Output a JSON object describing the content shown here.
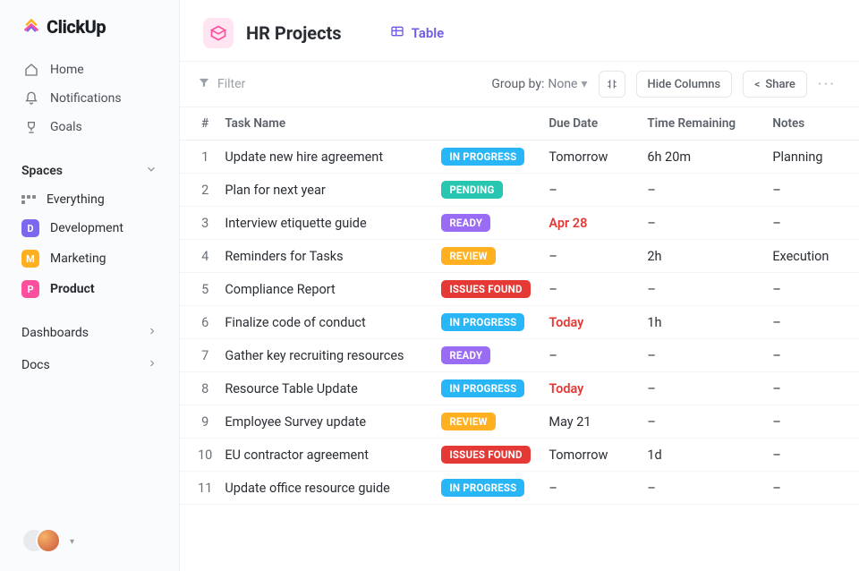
{
  "brand": {
    "name": "ClickUp"
  },
  "nav": {
    "home": "Home",
    "notifications": "Notifications",
    "goals": "Goals"
  },
  "sidebar": {
    "spaces_label": "Spaces",
    "everything": "Everything",
    "spaces": [
      {
        "letter": "D",
        "label": "Development",
        "class": "badge-d"
      },
      {
        "letter": "M",
        "label": "Marketing",
        "class": "badge-m"
      },
      {
        "letter": "P",
        "label": "Product",
        "class": "badge-p",
        "active": true
      }
    ],
    "dashboards": "Dashboards",
    "docs": "Docs"
  },
  "header": {
    "title": "HR Projects",
    "view_label": "Table"
  },
  "toolbar": {
    "filter": "Filter",
    "groupby_label": "Group by:",
    "groupby_value": "None",
    "hide_columns": "Hide Columns",
    "share": "Share"
  },
  "table": {
    "columns": {
      "num": "#",
      "task": "Task Name",
      "status": "",
      "due": "Due Date",
      "time": "Time Remaining",
      "notes": "Notes"
    },
    "status_labels": {
      "inprogress": "IN PROGRESS",
      "pending": "PENDING",
      "ready": "READY",
      "review": "REVIEW",
      "issues": "ISSUES FOUND"
    },
    "rows": [
      {
        "n": "1",
        "task": "Update new hire agreement",
        "status": "inprogress",
        "due": "Tomorrow",
        "due_hl": false,
        "time": "6h 20m",
        "notes": "Planning"
      },
      {
        "n": "2",
        "task": "Plan for next year",
        "status": "pending",
        "due": "–",
        "due_hl": false,
        "time": "–",
        "notes": "–"
      },
      {
        "n": "3",
        "task": "Interview etiquette guide",
        "status": "ready",
        "due": "Apr 28",
        "due_hl": true,
        "time": "–",
        "notes": "–"
      },
      {
        "n": "4",
        "task": "Reminders for Tasks",
        "status": "review",
        "due": "–",
        "due_hl": false,
        "time": "2h",
        "notes": "Execution"
      },
      {
        "n": "5",
        "task": "Compliance Report",
        "status": "issues",
        "due": "–",
        "due_hl": false,
        "time": "–",
        "notes": "–"
      },
      {
        "n": "6",
        "task": "Finalize code of conduct",
        "status": "inprogress",
        "due": "Today",
        "due_hl": true,
        "time": "1h",
        "notes": "–"
      },
      {
        "n": "7",
        "task": "Gather key recruiting resources",
        "status": "ready",
        "due": "–",
        "due_hl": false,
        "time": "–",
        "notes": "–"
      },
      {
        "n": "8",
        "task": "Resource Table Update",
        "status": "inprogress",
        "due": "Today",
        "due_hl": true,
        "time": "–",
        "notes": "–"
      },
      {
        "n": "9",
        "task": "Employee Survey update",
        "status": "review",
        "due": "May 21",
        "due_hl": false,
        "time": "–",
        "notes": "–"
      },
      {
        "n": "10",
        "task": "EU contractor agreement",
        "status": "issues",
        "due": "Tomorrow",
        "due_hl": false,
        "time": "1d",
        "notes": "–"
      },
      {
        "n": "11",
        "task": "Update office resource guide",
        "status": "inprogress",
        "due": "–",
        "due_hl": false,
        "time": "–",
        "notes": "–"
      }
    ]
  }
}
